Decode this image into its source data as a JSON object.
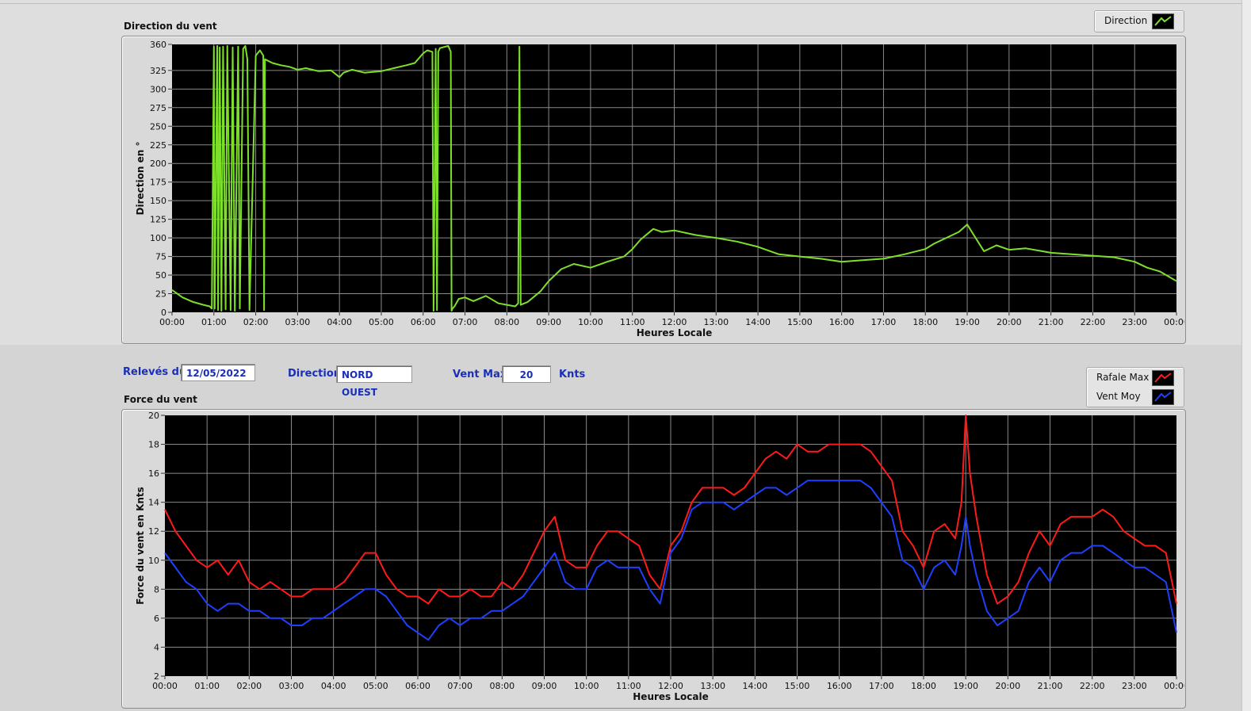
{
  "colors": {
    "direction": "#7ee02a",
    "gust": "#ff1a1a",
    "average": "#1f3fff",
    "plot_bg": "#000000",
    "grid": "#8a8a8a",
    "accent_text": "#1a2fb8"
  },
  "direction_panel": {
    "title": "Direction du vent",
    "legend": {
      "label": "Direction",
      "icon": "line-icon-green"
    }
  },
  "force_panel": {
    "title": "Force du vent",
    "legend": [
      {
        "label": "Rafale Max",
        "icon": "line-icon-red"
      },
      {
        "label": "Vent Moy",
        "icon": "line-icon-blue"
      }
    ]
  },
  "info_bar": {
    "date_label": "Relevés du",
    "date_value": "12/05/2022",
    "direction_label": "Direction",
    "direction_value": "NORD OUEST",
    "vent_max_label": "Vent Max",
    "vent_max_value": "20",
    "unit": "Knts"
  },
  "chart_data": [
    {
      "type": "line",
      "title": "Direction du vent",
      "xlabel": "Heures Locale",
      "ylabel": "Direction en °",
      "xlim": [
        0,
        24
      ],
      "ylim": [
        0,
        360
      ],
      "x_ticks": [
        "00:00",
        "01:00",
        "02:00",
        "03:00",
        "04:00",
        "05:00",
        "06:00",
        "07:00",
        "08:00",
        "09:00",
        "10:00",
        "11:00",
        "12:00",
        "13:00",
        "14:00",
        "15:00",
        "16:00",
        "17:00",
        "18:00",
        "19:00",
        "20:00",
        "21:00",
        "22:00",
        "23:00",
        "00:00"
      ],
      "y_ticks": [
        0,
        25,
        50,
        75,
        100,
        125,
        150,
        175,
        200,
        225,
        250,
        275,
        300,
        325,
        360
      ],
      "y_tick_labels": [
        "0",
        "25",
        "50",
        "75",
        "100",
        "125",
        "150",
        "175",
        "200",
        "225",
        "250",
        "275",
        "300",
        "325",
        "360"
      ],
      "grid": true,
      "legend_position": "top-right",
      "series": [
        {
          "name": "Direction",
          "x": [
            0,
            0.25,
            0.5,
            0.75,
            0.9,
            0.95,
            1.0,
            1.02,
            1.08,
            1.1,
            1.14,
            1.18,
            1.22,
            1.28,
            1.32,
            1.4,
            1.45,
            1.5,
            1.58,
            1.62,
            1.7,
            1.75,
            1.8,
            1.85,
            2.0,
            2.1,
            2.18,
            2.2,
            2.22,
            2.4,
            2.6,
            2.8,
            3.0,
            3.2,
            3.5,
            3.8,
            4.0,
            4.1,
            4.3,
            4.6,
            5.0,
            5.3,
            5.6,
            5.8,
            6.0,
            6.1,
            6.22,
            6.25,
            6.3,
            6.33,
            6.36,
            6.4,
            6.6,
            6.66,
            6.68,
            6.7,
            6.75,
            6.85,
            7.0,
            7.2,
            7.5,
            7.8,
            8.0,
            8.2,
            8.27,
            8.3,
            8.33,
            8.5,
            8.8,
            9.0,
            9.3,
            9.6,
            10.0,
            10.4,
            10.8,
            11.0,
            11.2,
            11.5,
            11.7,
            12.0,
            12.5,
            13.0,
            13.5,
            14.0,
            14.5,
            15.0,
            15.5,
            16.0,
            16.5,
            17.0,
            17.5,
            18.0,
            18.2,
            18.5,
            18.8,
            19.0,
            19.2,
            19.4,
            19.7,
            20.0,
            20.4,
            20.8,
            21.0,
            21.5,
            22.0,
            22.5,
            23.0,
            23.3,
            23.6,
            24.0
          ],
          "values": [
            30,
            20,
            14,
            10,
            8,
            5,
            357,
            5,
            358,
            3,
            356,
            2,
            357,
            4,
            358,
            3,
            356,
            2,
            357,
            5,
            354,
            358,
            340,
            3,
            345,
            352,
            345,
            3,
            340,
            335,
            332,
            330,
            326,
            328,
            324,
            325,
            316,
            322,
            326,
            322,
            324,
            328,
            332,
            335,
            348,
            352,
            350,
            2,
            354,
            3,
            350,
            355,
            358,
            350,
            2,
            5,
            8,
            18,
            20,
            15,
            22,
            12,
            10,
            8,
            12,
            357,
            10,
            14,
            28,
            42,
            58,
            65,
            60,
            68,
            75,
            85,
            98,
            112,
            108,
            110,
            104,
            100,
            95,
            88,
            78,
            75,
            72,
            68,
            70,
            72,
            78,
            85,
            92,
            100,
            108,
            118,
            100,
            82,
            90,
            84,
            86,
            82,
            80,
            78,
            76,
            74,
            68,
            60,
            55,
            42
          ]
        }
      ]
    },
    {
      "type": "line",
      "title": "Force du vent",
      "xlabel": "Heures Locale",
      "ylabel": "Force du vent en Knts",
      "xlim": [
        0,
        24
      ],
      "ylim": [
        2,
        20
      ],
      "x_ticks": [
        "00:00",
        "01:00",
        "02:00",
        "03:00",
        "04:00",
        "05:00",
        "06:00",
        "07:00",
        "08:00",
        "09:00",
        "10:00",
        "11:00",
        "12:00",
        "13:00",
        "14:00",
        "15:00",
        "16:00",
        "17:00",
        "18:00",
        "19:00",
        "20:00",
        "21:00",
        "22:00",
        "23:00",
        "00:00"
      ],
      "y_ticks": [
        2,
        4,
        6,
        8,
        10,
        12,
        14,
        16,
        18,
        20
      ],
      "grid": true,
      "legend_position": "top-right",
      "series": [
        {
          "name": "Rafale Max",
          "x": [
            0,
            0.25,
            0.5,
            0.75,
            1.0,
            1.25,
            1.5,
            1.75,
            2.0,
            2.25,
            2.5,
            2.75,
            3.0,
            3.25,
            3.5,
            3.75,
            4.0,
            4.25,
            4.5,
            4.75,
            5.0,
            5.25,
            5.5,
            5.75,
            6.0,
            6.25,
            6.5,
            6.75,
            7.0,
            7.25,
            7.5,
            7.75,
            8.0,
            8.25,
            8.5,
            8.75,
            9.0,
            9.25,
            9.5,
            9.75,
            10.0,
            10.25,
            10.5,
            10.75,
            11.0,
            11.25,
            11.5,
            11.75,
            12.0,
            12.25,
            12.5,
            12.75,
            13.0,
            13.25,
            13.5,
            13.75,
            14.0,
            14.25,
            14.5,
            14.75,
            15.0,
            15.25,
            15.5,
            15.75,
            16.0,
            16.25,
            16.5,
            16.75,
            17.0,
            17.25,
            17.5,
            17.75,
            18.0,
            18.25,
            18.5,
            18.75,
            18.9,
            19.0,
            19.1,
            19.25,
            19.5,
            19.75,
            20.0,
            20.25,
            20.5,
            20.75,
            21.0,
            21.25,
            21.5,
            21.75,
            22.0,
            22.25,
            22.5,
            22.75,
            23.0,
            23.25,
            23.5,
            23.75,
            24.0
          ],
          "values": [
            13.5,
            12,
            11,
            10,
            9.5,
            10,
            9,
            10,
            8.5,
            8,
            8.5,
            8,
            7.5,
            7.5,
            8,
            8,
            8,
            8.5,
            9.5,
            10.5,
            10.5,
            9,
            8,
            7.5,
            7.5,
            7,
            8,
            7.5,
            7.5,
            8,
            7.5,
            7.5,
            8.5,
            8,
            9,
            10.5,
            12,
            13,
            10,
            9.5,
            9.5,
            11,
            12,
            12,
            11.5,
            11,
            9,
            8,
            11,
            12,
            14,
            15,
            15,
            15,
            14.5,
            15,
            16,
            17,
            17.5,
            17,
            18,
            17.5,
            17.5,
            18,
            18,
            18,
            18,
            17.5,
            16.5,
            15.5,
            12,
            11,
            9.5,
            12,
            12.5,
            11.5,
            14,
            20,
            16,
            13,
            9,
            7,
            7.5,
            8.5,
            10.5,
            12,
            11,
            12.5,
            13,
            13,
            13,
            13.5,
            13,
            12,
            11.5,
            11,
            11,
            10.5,
            7
          ]
        },
        {
          "name": "Vent Moy",
          "x": [
            0,
            0.25,
            0.5,
            0.75,
            1.0,
            1.25,
            1.5,
            1.75,
            2.0,
            2.25,
            2.5,
            2.75,
            3.0,
            3.25,
            3.5,
            3.75,
            4.0,
            4.25,
            4.5,
            4.75,
            5.0,
            5.25,
            5.5,
            5.75,
            6.0,
            6.25,
            6.5,
            6.75,
            7.0,
            7.25,
            7.5,
            7.75,
            8.0,
            8.25,
            8.5,
            8.75,
            9.0,
            9.25,
            9.5,
            9.75,
            10.0,
            10.25,
            10.5,
            10.75,
            11.0,
            11.25,
            11.5,
            11.75,
            12.0,
            12.25,
            12.5,
            12.75,
            13.0,
            13.25,
            13.5,
            13.75,
            14.0,
            14.25,
            14.5,
            14.75,
            15.0,
            15.25,
            15.5,
            15.75,
            16.0,
            16.25,
            16.5,
            16.75,
            17.0,
            17.25,
            17.5,
            17.75,
            18.0,
            18.25,
            18.5,
            18.75,
            18.9,
            19.0,
            19.1,
            19.25,
            19.5,
            19.75,
            20.0,
            20.25,
            20.5,
            20.75,
            21.0,
            21.25,
            21.5,
            21.75,
            22.0,
            22.25,
            22.5,
            22.75,
            23.0,
            23.25,
            23.5,
            23.75,
            24.0
          ],
          "values": [
            10.5,
            9.5,
            8.5,
            8,
            7,
            6.5,
            7,
            7,
            6.5,
            6.5,
            6,
            6,
            5.5,
            5.5,
            6,
            6,
            6.5,
            7,
            7.5,
            8,
            8,
            7.5,
            6.5,
            5.5,
            5,
            4.5,
            5.5,
            6,
            5.5,
            6,
            6,
            6.5,
            6.5,
            7,
            7.5,
            8.5,
            9.5,
            10.5,
            8.5,
            8,
            8,
            9.5,
            10,
            9.5,
            9.5,
            9.5,
            8,
            7,
            10.5,
            11.5,
            13.5,
            14,
            14,
            14,
            13.5,
            14,
            14.5,
            15,
            15,
            14.5,
            15,
            15.5,
            15.5,
            15.5,
            15.5,
            15.5,
            15.5,
            15,
            14,
            13,
            10,
            9.5,
            8,
            9.5,
            10,
            9,
            11,
            13,
            11,
            9,
            6.5,
            5.5,
            6,
            6.5,
            8.5,
            9.5,
            8.5,
            10,
            10.5,
            10.5,
            11,
            11,
            10.5,
            10,
            9.5,
            9.5,
            9,
            8.5,
            5
          ]
        }
      ]
    }
  ]
}
